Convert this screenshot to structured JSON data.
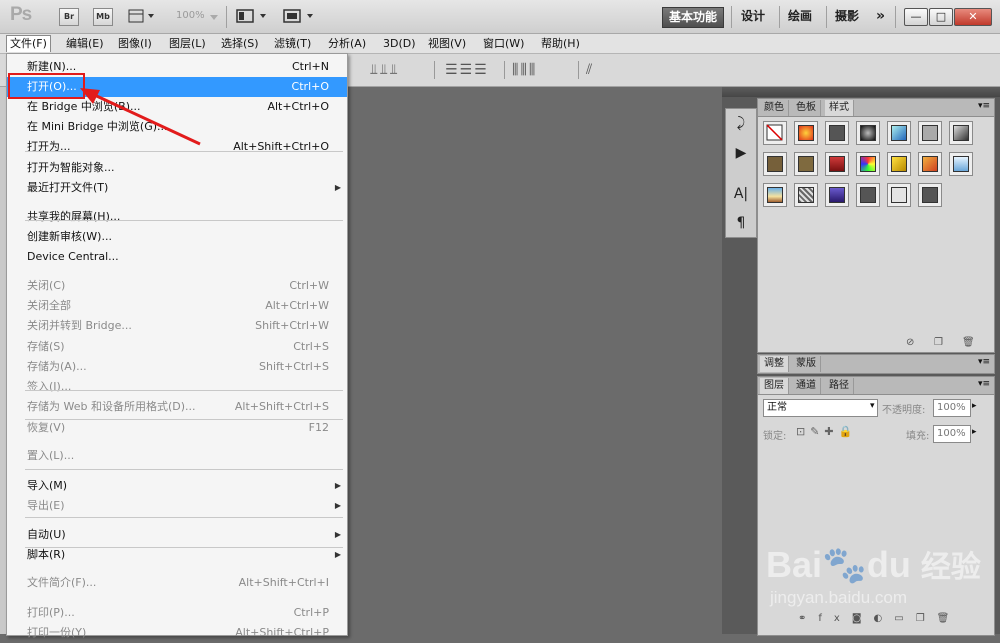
{
  "app": {
    "logo": "Ps"
  },
  "titlebar": {
    "br": "Br",
    "mb": "Mb",
    "zoom": "100%",
    "workspaces": [
      "基本功能",
      "设计",
      "绘画",
      "摄影"
    ],
    "more": "»",
    "win_min": "—",
    "win_max": "□",
    "win_close": "✕"
  },
  "menubar": {
    "items": [
      "文件(F)",
      "编辑(E)",
      "图像(I)",
      "图层(L)",
      "选择(S)",
      "滤镜(T)",
      "分析(A)",
      "3D(D)",
      "视图(V)",
      "窗口(W)",
      "帮助(H)"
    ]
  },
  "file_menu": {
    "groups": [
      [
        {
          "label": "新建(N)...",
          "shortcut": "Ctrl+N",
          "disabled": false
        },
        {
          "label": "打开(O)...",
          "shortcut": "Ctrl+O",
          "disabled": false,
          "highlighted": true
        },
        {
          "label": "在 Bridge 中浏览(B)...",
          "shortcut": "Alt+Ctrl+O",
          "disabled": false
        },
        {
          "label": "在 Mini Bridge 中浏览(G)...",
          "shortcut": "",
          "disabled": false
        },
        {
          "label": "打开为...",
          "shortcut": "Alt+Shift+Ctrl+O",
          "disabled": false
        },
        {
          "label": "打开为智能对象...",
          "shortcut": "",
          "disabled": false
        },
        {
          "label": "最近打开文件(T)",
          "shortcut": "",
          "disabled": false,
          "submenu": true
        }
      ],
      [
        {
          "label": "共享我的屏幕(H)...",
          "shortcut": "",
          "disabled": false
        },
        {
          "label": "创建新审核(W)...",
          "shortcut": "",
          "disabled": false
        },
        {
          "label": "Device Central...",
          "shortcut": "",
          "disabled": false
        }
      ],
      [
        {
          "label": "关闭(C)",
          "shortcut": "Ctrl+W",
          "disabled": true
        },
        {
          "label": "关闭全部",
          "shortcut": "Alt+Ctrl+W",
          "disabled": true
        },
        {
          "label": "关闭并转到 Bridge...",
          "shortcut": "Shift+Ctrl+W",
          "disabled": true
        },
        {
          "label": "存储(S)",
          "shortcut": "Ctrl+S",
          "disabled": true
        },
        {
          "label": "存储为(A)...",
          "shortcut": "Shift+Ctrl+S",
          "disabled": true
        },
        {
          "label": "签入(I)...",
          "shortcut": "",
          "disabled": true
        },
        {
          "label": "存储为 Web 和设备所用格式(D)...",
          "shortcut": "Alt+Shift+Ctrl+S",
          "disabled": true
        },
        {
          "label": "恢复(V)",
          "shortcut": "F12",
          "disabled": true
        }
      ],
      [
        {
          "label": "置入(L)...",
          "shortcut": "",
          "disabled": true
        }
      ],
      [
        {
          "label": "导入(M)",
          "shortcut": "",
          "disabled": false,
          "submenu": true
        },
        {
          "label": "导出(E)",
          "shortcut": "",
          "disabled": true,
          "submenu": true
        }
      ],
      [
        {
          "label": "自动(U)",
          "shortcut": "",
          "disabled": false,
          "submenu": true
        },
        {
          "label": "脚本(R)",
          "shortcut": "",
          "disabled": false,
          "submenu": true
        }
      ],
      [
        {
          "label": "文件简介(F)...",
          "shortcut": "Alt+Shift+Ctrl+I",
          "disabled": true
        }
      ],
      [
        {
          "label": "打印(P)...",
          "shortcut": "Ctrl+P",
          "disabled": true
        },
        {
          "label": "打印一份(Y)",
          "shortcut": "Alt+Shift+Ctrl+P",
          "disabled": true
        }
      ]
    ]
  },
  "style_panel": {
    "tabs": [
      "颜色",
      "色板",
      "样式"
    ],
    "active_tab": "样式"
  },
  "adjust_panel": {
    "tabs": [
      "调整",
      "蒙版"
    ]
  },
  "layers_panel": {
    "tabs": [
      "图层",
      "通道",
      "路径"
    ],
    "blend_mode": "正常",
    "opacity_label": "不透明度:",
    "opacity_value": "100%",
    "lock_label": "锁定:",
    "fill_label": "填充:",
    "fill_value": "100%"
  },
  "watermark": {
    "brand": "Bai",
    "brand2": "du",
    "cn": "经验",
    "url": "jingyan.baidu.com"
  },
  "colors": {
    "highlight": "#3399ff",
    "annotation": "#e21b1b"
  }
}
